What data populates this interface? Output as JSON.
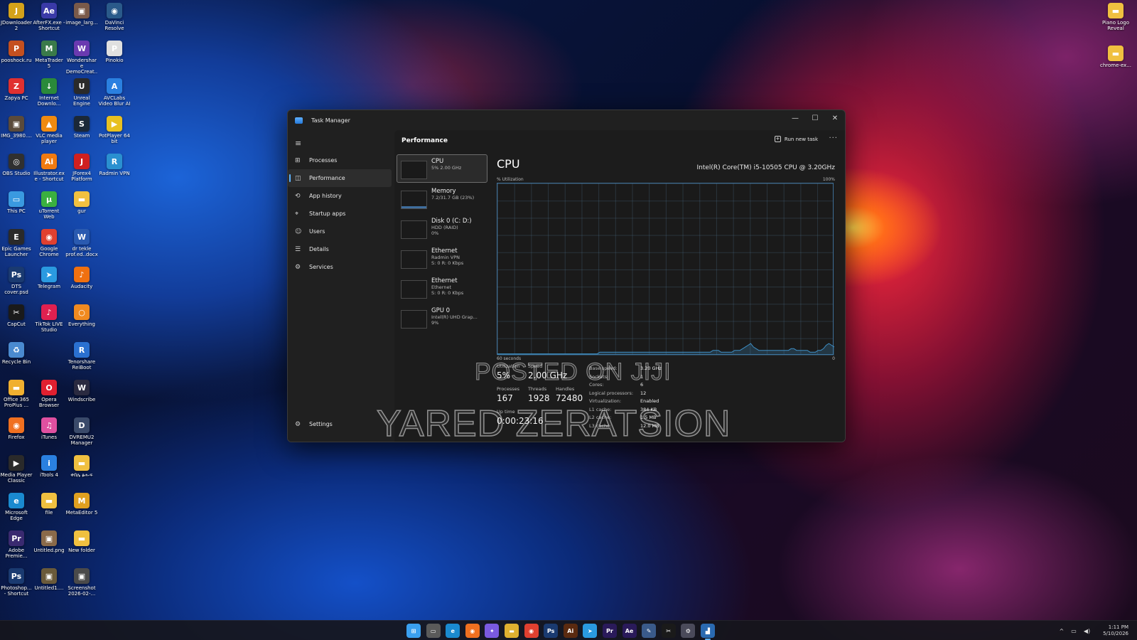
{
  "desktop": {
    "icons": [
      {
        "label": "JDownloader 2",
        "color": "#d4a21a",
        "glyph": "J"
      },
      {
        "label": "AfterFX.exe - Shortcut",
        "color": "#3a3aa8",
        "glyph": "Ae"
      },
      {
        "label": "image_larg...",
        "color": "#7a5a4a",
        "glyph": "▣"
      },
      {
        "label": "DaVinci Resolve",
        "color": "#2a5a8a",
        "glyph": "◉"
      },
      {
        "label": "pooshock.ru",
        "color": "#c45020",
        "glyph": "P"
      },
      {
        "label": "MetaTrader 5",
        "color": "#3a7a4a",
        "glyph": "M"
      },
      {
        "label": "Wondershare DemoCreat...",
        "color": "#6a3ab0",
        "glyph": "W"
      },
      {
        "label": "Pinokio",
        "color": "#e0e0e0",
        "glyph": "P"
      },
      {
        "label": "Zapya PC",
        "color": "#e03030",
        "glyph": "Z"
      },
      {
        "label": "Internet Downlo...",
        "color": "#2a8a3a",
        "glyph": "↓"
      },
      {
        "label": "Unreal Engine",
        "color": "#2a2a2a",
        "glyph": "U"
      },
      {
        "label": "AVCLabs Video Blur AI",
        "color": "#2a80e0",
        "glyph": "A"
      },
      {
        "label": "IMG_3980....",
        "color": "#5a4a3a",
        "glyph": "▣"
      },
      {
        "label": "VLC media player",
        "color": "#f08a10",
        "glyph": "▲"
      },
      {
        "label": "Steam",
        "color": "#1b2838",
        "glyph": "S"
      },
      {
        "label": "PotPlayer 64 bit",
        "color": "#e8c020",
        "glyph": "▶"
      },
      {
        "label": "OBS Studio",
        "color": "#303030",
        "glyph": "◎"
      },
      {
        "label": "Illustrator.exe - Shortcut",
        "color": "#f07a10",
        "glyph": "Ai"
      },
      {
        "label": "JForex4 Platform",
        "color": "#d02020",
        "glyph": "J"
      },
      {
        "label": "Radmin VPN",
        "color": "#2a90d0",
        "glyph": "R"
      },
      {
        "label": "This PC",
        "color": "#3a9ae0",
        "glyph": "▭"
      },
      {
        "label": "uTorrent Web",
        "color": "#3ab040",
        "glyph": "µ"
      },
      {
        "label": "gur",
        "color": "#f0c040",
        "glyph": "▬"
      },
      {
        "label": "",
        "color": "transparent",
        "glyph": ""
      },
      {
        "label": "Epic Games Launcher",
        "color": "#2a2a2a",
        "glyph": "E"
      },
      {
        "label": "Google Chrome",
        "color": "#e04030",
        "glyph": "◉"
      },
      {
        "label": "dr tekle prof.ed..docx",
        "color": "#2a5ab0",
        "glyph": "W"
      },
      {
        "label": "",
        "color": "transparent",
        "glyph": ""
      },
      {
        "label": "DTS cover.psd",
        "color": "#1a3a70",
        "glyph": "Ps"
      },
      {
        "label": "Telegram",
        "color": "#2a9ae0",
        "glyph": "➤"
      },
      {
        "label": "Audacity",
        "color": "#f07010",
        "glyph": "♪"
      },
      {
        "label": "",
        "color": "transparent",
        "glyph": ""
      },
      {
        "label": "CapCut",
        "color": "#1a1a1a",
        "glyph": "✂"
      },
      {
        "label": "TikTok LIVE Studio",
        "color": "#e02050",
        "glyph": "♪"
      },
      {
        "label": "Everything",
        "color": "#f08a20",
        "glyph": "○"
      },
      {
        "label": "",
        "color": "transparent",
        "glyph": ""
      },
      {
        "label": "Recycle Bin",
        "color": "#4a8ad0",
        "glyph": "♻"
      },
      {
        "label": "",
        "color": "transparent",
        "glyph": ""
      },
      {
        "label": "Tenorshare ReiBoot",
        "color": "#2a70d0",
        "glyph": "R"
      },
      {
        "label": "",
        "color": "transparent",
        "glyph": ""
      },
      {
        "label": "Office 365 ProPlus ...",
        "color": "#f0b030",
        "glyph": "▬"
      },
      {
        "label": "Opera Browser",
        "color": "#e02030",
        "glyph": "O"
      },
      {
        "label": "Windscribe",
        "color": "#2a2a40",
        "glyph": "W"
      },
      {
        "label": "",
        "color": "transparent",
        "glyph": ""
      },
      {
        "label": "Firefox",
        "color": "#f07020",
        "glyph": "◉"
      },
      {
        "label": "iTunes",
        "color": "#e050a0",
        "glyph": "♫"
      },
      {
        "label": "DVREMU2 Manager",
        "color": "#3a4a6a",
        "glyph": "D"
      },
      {
        "label": "",
        "color": "transparent",
        "glyph": ""
      },
      {
        "label": "Media Player Classic",
        "color": "#2a2a2a",
        "glyph": "▶"
      },
      {
        "label": "iTools 4",
        "color": "#2a80e0",
        "glyph": "i"
      },
      {
        "label": "ቀበሌ ፅሑፍ",
        "color": "#f0c040",
        "glyph": "▬"
      },
      {
        "label": "",
        "color": "transparent",
        "glyph": ""
      },
      {
        "label": "Microsoft Edge",
        "color": "#1a8ad0",
        "glyph": "e"
      },
      {
        "label": "file",
        "color": "#f0c040",
        "glyph": "▬"
      },
      {
        "label": "MetaEditor 5",
        "color": "#e0a020",
        "glyph": "M"
      },
      {
        "label": "",
        "color": "transparent",
        "glyph": ""
      },
      {
        "label": "Adobe Premie...",
        "color": "#3a2a70",
        "glyph": "Pr"
      },
      {
        "label": "Untitled.png",
        "color": "#8a6a4a",
        "glyph": "▣"
      },
      {
        "label": "New folder",
        "color": "#f0c040",
        "glyph": "▬"
      },
      {
        "label": "",
        "color": "transparent",
        "glyph": ""
      },
      {
        "label": "Photoshop... - Shortcut",
        "color": "#1a3a70",
        "glyph": "Ps"
      },
      {
        "label": "Untitled1....",
        "color": "#6a5a3a",
        "glyph": "▣"
      },
      {
        "label": "Screenshot 2026-02-...",
        "color": "#4a4a4a",
        "glyph": "▣"
      }
    ],
    "right_icons": [
      {
        "label": "Piano Logo Reveal",
        "color": "#f0c040",
        "glyph": "▬"
      },
      {
        "label": "chrome-ex...",
        "color": "#f0c040",
        "glyph": "▬"
      }
    ]
  },
  "window": {
    "title": "Task Manager",
    "minimize": "—",
    "maximize": "☐",
    "close": "✕"
  },
  "sidebar": {
    "menu_icon": "≡",
    "items": [
      {
        "label": "Processes",
        "icon": "processes-icon",
        "glyph": "⊞"
      },
      {
        "label": "Performance",
        "icon": "performance-icon",
        "glyph": "◫"
      },
      {
        "label": "App history",
        "icon": "history-icon",
        "glyph": "⟲"
      },
      {
        "label": "Startup apps",
        "icon": "startup-icon",
        "glyph": "⌖"
      },
      {
        "label": "Users",
        "icon": "users-icon",
        "glyph": "☺"
      },
      {
        "label": "Details",
        "icon": "details-icon",
        "glyph": "☰"
      },
      {
        "label": "Services",
        "icon": "services-icon",
        "glyph": "⚙"
      }
    ],
    "settings": {
      "label": "Settings",
      "glyph": "⚙"
    }
  },
  "header": {
    "title": "Performance",
    "run_new_task": "Run new task",
    "more": "···"
  },
  "devices": [
    {
      "name": "CPU",
      "line1": "5%  2.00 GHz",
      "line2": ""
    },
    {
      "name": "Memory",
      "line1": "7.2/31.7 GB (23%)",
      "line2": ""
    },
    {
      "name": "Disk 0 (C: D:)",
      "line1": "HDD (RAID)",
      "line2": "0%"
    },
    {
      "name": "Ethernet",
      "line1": "Radmin VPN",
      "line2": "S: 0 R: 0 Kbps"
    },
    {
      "name": "Ethernet",
      "line1": "Ethernet",
      "line2": "S: 0 R: 0 Kbps"
    },
    {
      "name": "GPU 0",
      "line1": "Intel(R) UHD Grap...",
      "line2": "9%"
    }
  ],
  "cpu": {
    "title": "CPU",
    "model": "Intel(R) Core(TM) i5-10505 CPU @ 3.20GHz",
    "util_label": "% Utilization",
    "util_max": "100%",
    "graph_left": "60 seconds",
    "graph_right": "0",
    "graph_color": "#3e8ec4",
    "history_percent": [
      1,
      1,
      1,
      1,
      1,
      1,
      1,
      1,
      1,
      1,
      1,
      1,
      1,
      1,
      1,
      1,
      1,
      1,
      1,
      1,
      1,
      1,
      1,
      1,
      1,
      1,
      1,
      1,
      1,
      1,
      1,
      1,
      1,
      1,
      1,
      1,
      1,
      1,
      2,
      2,
      2,
      2,
      2,
      2,
      2,
      2,
      2,
      2,
      2,
      2,
      2,
      2,
      2,
      2,
      2,
      2,
      2,
      2,
      2,
      2,
      2,
      2,
      2,
      2,
      2,
      2,
      2,
      2,
      2,
      2,
      2,
      2,
      2,
      2,
      2,
      2,
      2,
      2,
      2,
      2,
      3,
      3,
      3,
      2,
      2,
      2,
      2,
      2,
      3,
      3,
      3,
      4,
      5,
      6,
      7,
      5,
      4,
      3,
      3,
      3,
      3,
      3,
      3,
      3,
      3,
      3,
      3,
      3,
      3,
      4,
      4,
      3,
      3,
      3,
      3,
      3,
      2,
      2,
      2,
      3,
      3,
      4,
      6,
      7,
      6,
      5
    ],
    "stats": {
      "utilization_label": "Utilization",
      "utilization": "5%",
      "speed_label": "Speed",
      "speed": "2.00 GHz",
      "processes_label": "Processes",
      "processes": "167",
      "threads_label": "Threads",
      "threads": "1928",
      "handles_label": "Handles",
      "handles": "72480",
      "uptime_label": "Up time",
      "uptime": "0:00:23:16"
    },
    "specs": [
      {
        "k": "Base speed:",
        "v": "3.20 GHz"
      },
      {
        "k": "Sockets:",
        "v": "1"
      },
      {
        "k": "Cores:",
        "v": "6"
      },
      {
        "k": "Logical processors:",
        "v": "12"
      },
      {
        "k": "Virtualization:",
        "v": "Enabled"
      },
      {
        "k": "L1 cache:",
        "v": "384 KB"
      },
      {
        "k": "L2 cache:",
        "v": "1.5 MB"
      },
      {
        "k": "L3 cache:",
        "v": "12.0 MB"
      }
    ]
  },
  "watermark": {
    "line1": "POSTED ON JIJI",
    "line2": "YARED ZERATSION"
  },
  "taskbar": {
    "apps": [
      {
        "name": "start",
        "glyph": "⊞",
        "color": "#3aa0f0"
      },
      {
        "name": "file-explorer",
        "glyph": "▭",
        "color": "#5a5a5a"
      },
      {
        "name": "edge",
        "glyph": "e",
        "color": "#1a8ad0"
      },
      {
        "name": "firefox",
        "glyph": "◉",
        "color": "#f07020"
      },
      {
        "name": "copilot",
        "glyph": "✦",
        "color": "#7a5ae0"
      },
      {
        "name": "folder",
        "glyph": "▬",
        "color": "#e0b030"
      },
      {
        "name": "chrome",
        "glyph": "◉",
        "color": "#e04030"
      },
      {
        "name": "photoshop",
        "glyph": "Ps",
        "color": "#1a3a70"
      },
      {
        "name": "illustrator",
        "glyph": "Ai",
        "color": "#5a2a10"
      },
      {
        "name": "telegram",
        "glyph": "➤",
        "color": "#2a9ae0"
      },
      {
        "name": "premiere",
        "glyph": "Pr",
        "color": "#2a1a5a"
      },
      {
        "name": "after-effects",
        "glyph": "Ae",
        "color": "#2a1a5a"
      },
      {
        "name": "paint",
        "glyph": "✎",
        "color": "#3a5a8a"
      },
      {
        "name": "capcut",
        "glyph": "✂",
        "color": "#1a1a1a"
      },
      {
        "name": "settings",
        "glyph": "⚙",
        "color": "#4a4a5a"
      },
      {
        "name": "task-manager",
        "glyph": "▟",
        "color": "#2a6ab0"
      }
    ],
    "tray_chevron": "^",
    "tray_network": "▭",
    "tray_volume": "◀)",
    "time": "1:11 PM",
    "date": "5/10/2026"
  }
}
